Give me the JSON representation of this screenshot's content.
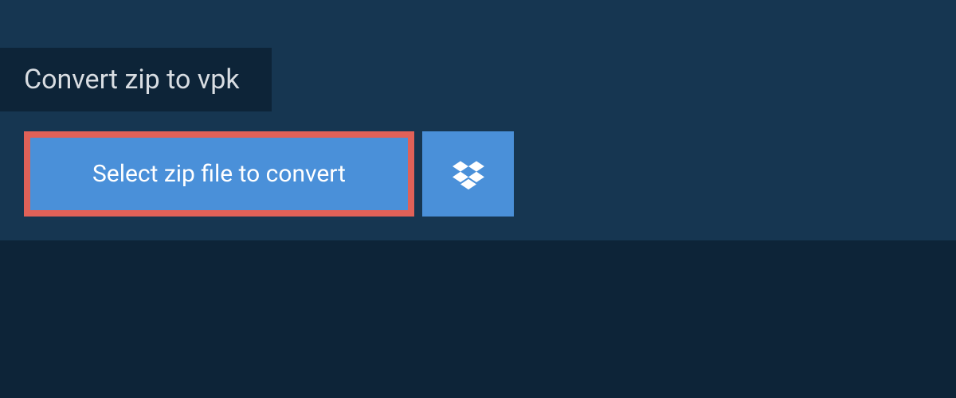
{
  "title": "Convert zip to vpk",
  "select_button_label": "Select zip file to convert",
  "colors": {
    "page_bg": "#0d2438",
    "panel_bg": "#163651",
    "button_bg": "#4a90d9",
    "button_border": "#e06158",
    "text_light": "#d8dde2",
    "text_white": "#ffffff"
  }
}
